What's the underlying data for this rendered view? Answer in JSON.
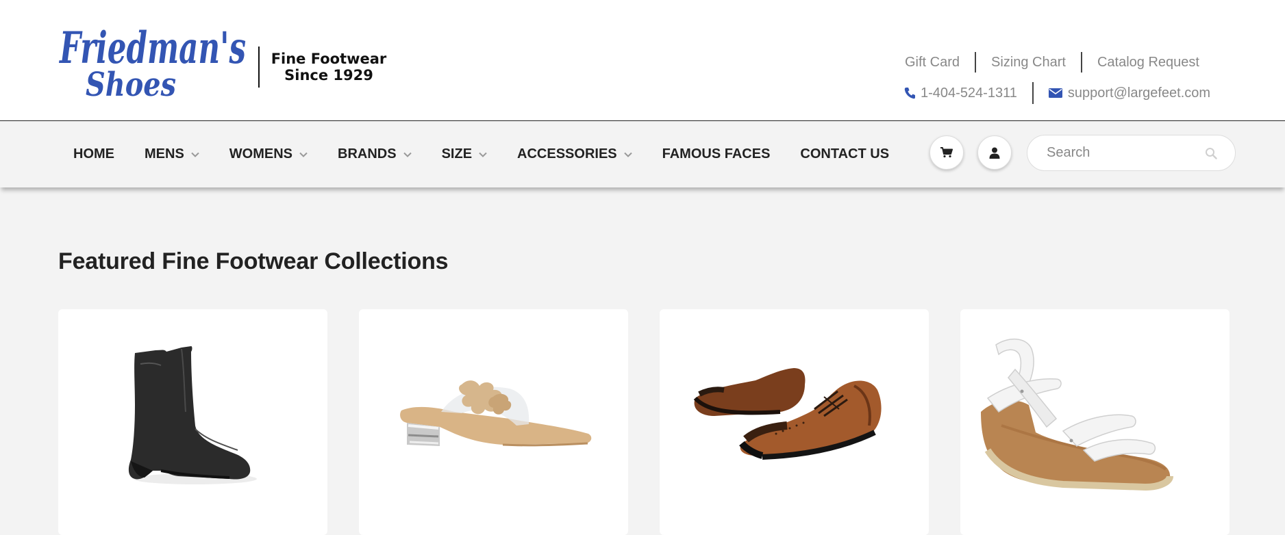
{
  "logo": {
    "script_line1": "Friedman's",
    "script_line2": "Shoes",
    "tagline_line1": "Fine Footwear",
    "tagline_line2": "Since 1929",
    "brand_color": "#3355b3"
  },
  "utility_links": [
    {
      "label": "Gift Card"
    },
    {
      "label": "Sizing Chart"
    },
    {
      "label": "Catalog Request"
    }
  ],
  "contact": {
    "phone": "1-404-524-1311",
    "phone_icon": "phone-icon",
    "email": "support@largefeet.com",
    "email_icon": "envelope-icon",
    "icon_color": "#3355b3"
  },
  "nav": {
    "items": [
      {
        "label": "HOME",
        "dropdown": false
      },
      {
        "label": "MENS",
        "dropdown": true
      },
      {
        "label": "WOMENS",
        "dropdown": true
      },
      {
        "label": "BRANDS",
        "dropdown": true
      },
      {
        "label": "SIZE",
        "dropdown": true
      },
      {
        "label": "ACCESSORIES",
        "dropdown": true
      },
      {
        "label": "FAMOUS FACES",
        "dropdown": false
      },
      {
        "label": "CONTACT US",
        "dropdown": false
      }
    ],
    "cart_icon": "cart-icon",
    "account_icon": "user-icon",
    "search_placeholder": "Search"
  },
  "main": {
    "section_title": "Featured Fine Footwear Collections",
    "cards": [
      {
        "product": "black-ankle-boot-image"
      },
      {
        "product": "clear-heeled-sandal-image"
      },
      {
        "product": "brown-wingtip-oxfords-image"
      },
      {
        "product": "white-wedge-sandal-image"
      }
    ]
  }
}
